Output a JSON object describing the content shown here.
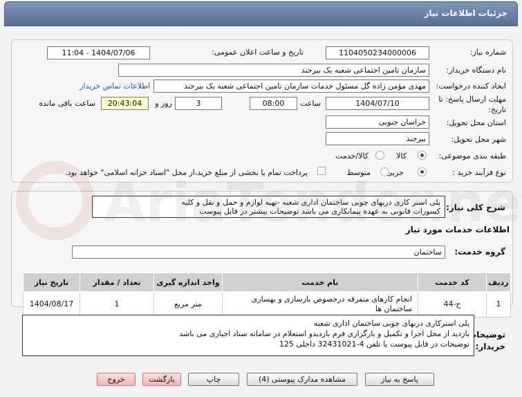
{
  "header": {
    "title": "جزئیات اطلاعات نیاز"
  },
  "form": {
    "need_number_label": "شماره نیاز:",
    "need_number": "1104050234000006",
    "announce_label": "تاریخ و ساعت اعلان عمومی:",
    "announce_value": "1404/07/06 - 11:04",
    "buyer_label": "نام دستگاه خریدار:",
    "buyer_value": "سازمان تامین اجتماعی شعبه یک بیرجند",
    "creator_label": "ایجاد کننده درخواست:",
    "creator_value": "مهدی مؤمن زاده گل مسئول خدمات  سازمان تامین اجتماعی شعبه یک بیرجند",
    "contact_link": "اطلاعات تماس خریدار",
    "deadline_label": "مهلت ارسال پاسخ: تا تاریخ:",
    "deadline_date": "1404/07/10",
    "time_label": "ساعت",
    "deadline_time": "08:00",
    "days_value": "3",
    "days_label": "روز و",
    "remaining_time": "20:43:04",
    "remaining_label": "ساعت باقی مانده",
    "province_label": "استان محل تحویل:",
    "province_value": "خراسان جنوبی",
    "city_label": "شهر محل تحویل:",
    "city_value": "بیرجند",
    "category_label": "طبقه بندی موضوعی:",
    "category_opt1": "کالا",
    "category_opt2": "کالا/خدمت",
    "process_label": "نوع فرآیند خرید :",
    "process_opt1": "جزیی",
    "process_opt2": "متوسط",
    "payment_note": "پرداخت تمام یا بخشی از مبلغ خرید،از محل \"اسناد خزانه اسلامی\" خواهد بود."
  },
  "description": {
    "label": "شرح کلی نیاز:",
    "line1": "پلی استر کاری دربهای چوبی ساختمان اداری شعبه -تهیه لوازم و حمل و نقل و کلیه",
    "line2": "کسورات قانونی  به عهده پیمانکاری می باشد توضیحات بیشتر  در فایل پیوست"
  },
  "services": {
    "title": "اطلاعات خدمات مورد نیاز",
    "group_label": "گروه خدمت:",
    "group_value": "ساختمان",
    "columns": [
      "ردیف",
      "کد خدمت",
      "نام خدمت",
      "واحد اندازه گیری",
      "تعداد / مقدار",
      "تاریخ نیاز"
    ],
    "row": {
      "index": "1",
      "code": "ج-44",
      "name": "انجام کارهای متفرقه درخصوص بازسازی و بهسازی ساختمان ها",
      "unit": "متر مربع",
      "qty": "1",
      "date": "1404/08/17"
    }
  },
  "buyer_notes": {
    "label": "توضیحات خریدار:",
    "line1": "پلی استرکاری دربهای چوبی ساختمان اداری شعبه",
    "line2": "بازدید از محل اجرا و تکمیل و بارگزاری فرم بازدیدو استعلام در سامانه ستاد اجباری می باشد",
    "line3": "توضیحات در فایل پیوست یا تلفن 4-32431021 داخلی 125"
  },
  "buttons": {
    "reply": "پاسخ به نیاز",
    "attachments": "مشاهده مدارک پیوستی (4)",
    "print": "چاپ",
    "back": "بازگشت",
    "exit": "خروج"
  },
  "watermark": {
    "text": "AriaTender.net"
  },
  "colors": {
    "header": "#6d83a8",
    "link": "#1c57d0",
    "remaining_bg": "#ffffc6"
  }
}
